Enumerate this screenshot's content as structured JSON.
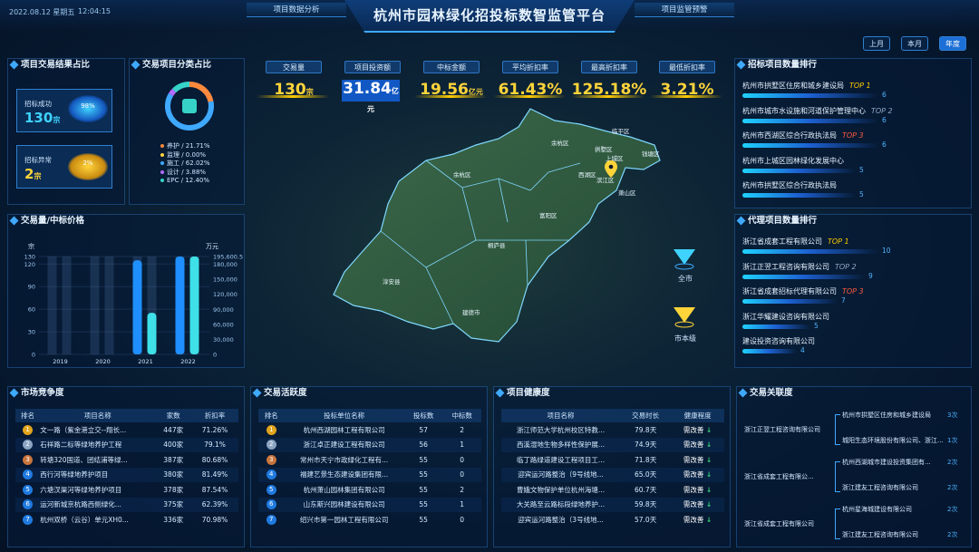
{
  "header": {
    "date": "2022.08.12 星期五",
    "time": "12:04:15",
    "title": "杭州市园林绿化招投标数智监管平台",
    "nav_left": "项目数据分析",
    "nav_right": "项目监管预警"
  },
  "periods": [
    "上月",
    "本月",
    "年度"
  ],
  "kpis": [
    {
      "label": "交易量",
      "value": "130",
      "unit": "宗"
    },
    {
      "label": "项目投资额",
      "value": "31.84",
      "unit": "亿元"
    },
    {
      "label": "中标金额",
      "value": "19.56",
      "unit": "亿元"
    },
    {
      "label": "平均折扣率",
      "value": "61.43%",
      "unit": ""
    },
    {
      "label": "最高折扣率",
      "value": "125.18%",
      "unit": ""
    },
    {
      "label": "最低折扣率",
      "value": "3.21%",
      "unit": ""
    }
  ],
  "result": {
    "title": "项目交易结果占比",
    "success": {
      "label": "招标成功",
      "value": "130",
      "unit": "宗",
      "pct": "98%"
    },
    "fail": {
      "label": "招标异常",
      "value": "2",
      "unit": "宗",
      "pct": "2%"
    }
  },
  "category": {
    "title": "交易项目分类占比",
    "legend": [
      "养护 / 21.71%",
      "监理 / 0.00%",
      "施工 / 62.02%",
      "设计 / 3.88%",
      "EPC / 12.40%"
    ],
    "colors": [
      "#ff8a3c",
      "#ffd43a",
      "#3fa9ff",
      "#b36bff",
      "#36d4c8"
    ],
    "shares": [
      0.2171,
      0.0,
      0.6202,
      0.0388,
      0.124
    ]
  },
  "volume_chart": {
    "title": "交易量/中标价格",
    "left_unit": "宗",
    "right_unit": "万元"
  },
  "chart_data": {
    "type": "bar",
    "categories": [
      "2019",
      "2020",
      "2021",
      "2022"
    ],
    "series": [
      {
        "name": "交易量",
        "values": [
          0,
          0,
          125,
          130
        ]
      },
      {
        "name": "中标价格",
        "values": [
          0,
          0,
          83000,
          195600.5
        ]
      }
    ],
    "ylim": [
      0,
      130
    ],
    "y2lim": [
      0,
      195600.5
    ],
    "yticks": [
      "0",
      "30",
      "60",
      "90",
      "120",
      "130"
    ],
    "y2ticks": [
      "0",
      "30,000",
      "60,000",
      "90,000",
      "120,000",
      "150,000",
      "180,000",
      "195,600.5"
    ]
  },
  "map": {
    "districts": [
      "余杭区",
      "临平区",
      "钱塘区",
      "西湖区",
      "上城区",
      "滨江区",
      "萧山区",
      "富阳区",
      "临安区",
      "桐庐县",
      "淳安县",
      "建德市",
      "拱墅区"
    ],
    "btn_city": "全市",
    "btn_level": "市本级"
  },
  "bid_ranking": {
    "title": "招标项目数量排行",
    "items": [
      {
        "name": "杭州市拱墅区住房和城乡建设局",
        "tag": "TOP 1",
        "count": "6"
      },
      {
        "name": "杭州市城市水设施和河道保护管理中心",
        "tag": "TOP 2",
        "count": "6"
      },
      {
        "name": "杭州市西湖区综合行政执法局",
        "tag": "TOP 3",
        "count": "6"
      },
      {
        "name": "杭州市上城区园林绿化发展中心",
        "tag": "",
        "count": "5"
      },
      {
        "name": "杭州市拱墅区综合行政执法局",
        "tag": "",
        "count": "5"
      }
    ]
  },
  "agent_ranking": {
    "title": "代理项目数量排行",
    "items": [
      {
        "name": "浙江省成套工程有限公司",
        "tag": "TOP 1",
        "count": "10"
      },
      {
        "name": "浙江正翌工程咨询有限公司",
        "tag": "TOP 2",
        "count": "9"
      },
      {
        "name": "浙江省成套招标代理有限公司",
        "tag": "TOP 3",
        "count": "7"
      },
      {
        "name": "浙江华耀建设咨询有限公司",
        "tag": "",
        "count": "5"
      },
      {
        "name": "建设投资咨询有限公司",
        "tag": "",
        "count": "4"
      }
    ]
  },
  "competition": {
    "title": "市场竞争度",
    "headers": [
      "排名",
      "项目名称",
      "家数",
      "折扣率"
    ],
    "rows": [
      [
        "1",
        "文一路（紫金港立交--翔长...",
        "447家",
        "71.26%"
      ],
      [
        "2",
        "石祥路二标等绿地养护工程",
        "400家",
        "79.1%"
      ],
      [
        "3",
        "转塘320国道、团结浦等绿...",
        "387家",
        "80.68%"
      ],
      [
        "4",
        "西行河等绿地养护项目",
        "380家",
        "81.49%"
      ],
      [
        "5",
        "六塘汊渠河等绿地养护项目",
        "378家",
        "87.54%"
      ],
      [
        "6",
        "运河新城京杭路西侧绿化...",
        "375家",
        "62.39%"
      ],
      [
        "7",
        "杭州双桥（云谷）单元XH0...",
        "336家",
        "70.98%"
      ]
    ]
  },
  "activity": {
    "title": "交易活跃度",
    "headers": [
      "排名",
      "投标单位名称",
      "投标数",
      "中标数"
    ],
    "rows": [
      [
        "1",
        "杭州西湖园林工程有限公司",
        "57",
        "2"
      ],
      [
        "2",
        "浙江卓正建设工程有限公司",
        "56",
        "1"
      ],
      [
        "3",
        "常州市天宁市政绿化工程有...",
        "55",
        "0"
      ],
      [
        "4",
        "福建艺景生态建设集团有限...",
        "55",
        "0"
      ],
      [
        "5",
        "杭州萧山园林集团有限公司",
        "55",
        "2"
      ],
      [
        "6",
        "山东斯兴园林建设有限公司",
        "55",
        "1"
      ],
      [
        "7",
        "绍兴市第一园林工程有限公司",
        "55",
        "0"
      ]
    ]
  },
  "health": {
    "title": "项目健康度",
    "headers": [
      "项目名称",
      "交易时长",
      "健康程度"
    ],
    "rows": [
      [
        "浙江师范大学杭州校区特教...",
        "79.8天",
        "需改善"
      ],
      [
        "西溪湿地生物多样性保护展...",
        "74.9天",
        "需改善"
      ],
      [
        "临丁路绿道建设工程项目工...",
        "71.8天",
        "需改善"
      ],
      [
        "迎宾运河路整治（9号线地...",
        "65.0天",
        "需改善"
      ],
      [
        "曹娥文物保护单位杭州海塘...",
        "60.7天",
        "需改善"
      ],
      [
        "大关路至云路标段绿地养护...",
        "59.8天",
        "需改善"
      ],
      [
        "迎宾运河路整治（3号线地...",
        "57.0天",
        "需改善"
      ]
    ]
  },
  "relation": {
    "title": "交易关联度",
    "groups": [
      {
        "agent": "浙江正翌工程咨询有限公司",
        "targets": [
          {
            "name": "杭州市拱墅区住房和城乡建设局",
            "count": "3次"
          },
          {
            "name": "城阳生态环境股份有限公司、浙江...",
            "count": "1次"
          }
        ]
      },
      {
        "agent": "浙江省成套工程有限公...",
        "targets": [
          {
            "name": "杭州西湖城市建设投资集团有...",
            "count": "2次"
          },
          {
            "name": "浙江建友工程咨询有限公司",
            "count": "2次"
          }
        ]
      },
      {
        "agent": "浙江省成套工程有限公司",
        "targets": [
          {
            "name": "杭州星海城建设有限公司",
            "count": "2次"
          },
          {
            "name": "浙江建友工程咨询有限公司",
            "count": "2次"
          }
        ]
      }
    ]
  }
}
